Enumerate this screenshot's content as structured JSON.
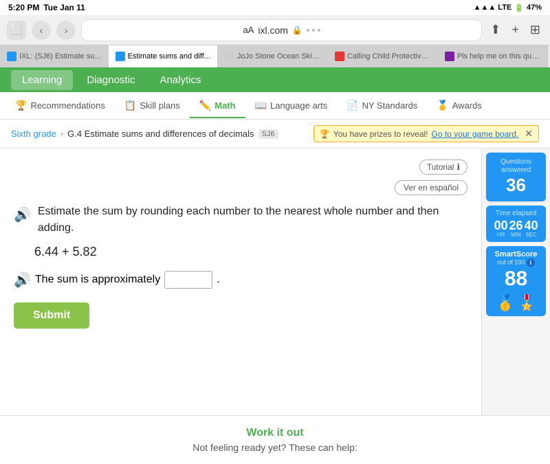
{
  "status_bar": {
    "time": "5:20 PM",
    "day": "Tue Jan 11",
    "signal": "LTE",
    "battery": "47%"
  },
  "browser": {
    "dots": "•••",
    "address": "ixl.com",
    "font_btn": "aA"
  },
  "tabs": [
    {
      "id": "tab-ixl",
      "label": "IXL: (SJ6) Estimate su...",
      "favicon_class": "ixl",
      "active": false
    },
    {
      "id": "tab-estimate",
      "label": "Estimate sums and diff...",
      "favicon_class": "ixl2",
      "active": true
    },
    {
      "id": "tab-jojo",
      "label": "JoJo Stone Ocean Skin...",
      "favicon_class": "jojo",
      "active": false
    },
    {
      "id": "tab-calling",
      "label": "Calling Child Protective...",
      "favicon_class": "calling",
      "active": false
    },
    {
      "id": "tab-help",
      "label": "Pls help me on this que...",
      "favicon_class": "help",
      "active": false
    }
  ],
  "nav": {
    "items": [
      {
        "label": "Learning",
        "active": true
      },
      {
        "label": "Diagnostic",
        "active": false
      },
      {
        "label": "Analytics",
        "active": false
      }
    ]
  },
  "sub_nav": {
    "tabs": [
      {
        "label": "Recommendations",
        "icon": "🏆",
        "active": false
      },
      {
        "label": "Skill plans",
        "icon": "📋",
        "active": false
      },
      {
        "label": "Math",
        "icon": "✏️",
        "active": true
      },
      {
        "label": "Language arts",
        "icon": "📖",
        "active": false
      },
      {
        "label": "NY Standards",
        "icon": "📄",
        "active": false
      },
      {
        "label": "Awards",
        "icon": "🥇",
        "active": false
      }
    ]
  },
  "breadcrumb": {
    "parent": "Sixth grade",
    "current": "G.4 Estimate sums and differences of decimals",
    "badge": "SJ6"
  },
  "prize_banner": {
    "text": "You have prizes to reveal!",
    "link_text": "Go to your game board."
  },
  "question": {
    "tutorial_label": "Tutorial",
    "spanish_label": "Ver en español",
    "instruction": "Estimate the sum by rounding each number to the nearest whole number and then adding.",
    "expression": "6.44 + 5.82",
    "answer_prompt": "The sum is approximately",
    "answer_suffix": ".",
    "submit_label": "Submit"
  },
  "stats": {
    "questions_answered_label": "Questions answered",
    "questions_answered_value": "36",
    "time_elapsed_label": "Time elapsed",
    "time_hr": "00",
    "time_min": "26",
    "time_sec": "40",
    "time_hr_label": "HR",
    "time_min_label": "MIN",
    "time_sec_label": "SEC",
    "smart_score_title": "SmartScore",
    "smart_score_sub": "out of 100",
    "smart_score_value": "88"
  },
  "bottom": {
    "heading": "Work it out",
    "subtext": "Not feeling ready yet? These can help:"
  }
}
